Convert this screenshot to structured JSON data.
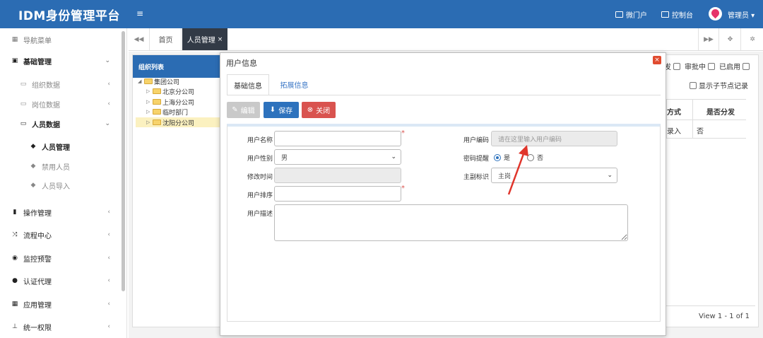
{
  "header": {
    "app_title": "IDM身份管理平台",
    "menu_toggle": "≡",
    "links": [
      {
        "label": "微门户",
        "icon": "id-card-icon"
      },
      {
        "label": "控制台",
        "icon": "monitor-icon"
      }
    ],
    "user_label": "管理员 ▾"
  },
  "sidebar": {
    "nav_title": "导航菜单",
    "items": [
      {
        "label": "基础管理",
        "icon": "id-card-icon",
        "arrow": "⌄"
      },
      {
        "label": "组织数据",
        "arrow": "‹"
      },
      {
        "label": "岗位数据",
        "arrow": "‹"
      },
      {
        "label": "人员数据",
        "arrow": "⌄"
      },
      {
        "label": "人员管理"
      },
      {
        "label": "禁用人员"
      },
      {
        "label": "人员导入"
      },
      {
        "label": "操作管理",
        "icon": "book-icon",
        "arrow": "‹"
      },
      {
        "label": "流程中心",
        "icon": "random-icon",
        "arrow": "‹"
      },
      {
        "label": "监控预警",
        "icon": "eye-icon",
        "arrow": "‹"
      },
      {
        "label": "认证代理",
        "icon": "users-icon",
        "arrow": "‹"
      },
      {
        "label": "应用管理",
        "icon": "grid-icon",
        "arrow": "‹"
      },
      {
        "label": "统一权限",
        "icon": "sitemap-icon",
        "arrow": "‹"
      }
    ]
  },
  "tabs": {
    "home": "首页",
    "active": "人员管理",
    "close": "×"
  },
  "org_panel": {
    "title": "组织列表",
    "tree": [
      "集团公司",
      "北京分公司",
      "上海分公司",
      "临时部门",
      "沈阳分公司"
    ]
  },
  "background": {
    "filters": [
      "发",
      "审批中",
      "已启用"
    ],
    "show_child": "显示子节点记录",
    "columns": [
      "方式",
      "是否分发"
    ],
    "row": [
      "录入",
      "否"
    ],
    "pagination": "View 1 - 1 of 1"
  },
  "modal": {
    "title": "用户信息",
    "close": "×",
    "tabs": [
      "基础信息",
      "拓展信息"
    ],
    "buttons": {
      "edit": "编辑",
      "save": "保存",
      "close": "关闭"
    },
    "form": {
      "user_name_label": "用户名称",
      "user_code_label": "用户编码",
      "user_code_placeholder": "请在这里输入用户编码",
      "gender_label": "用户性别",
      "gender_value": "男",
      "password_remind_label": "密码提醒",
      "radio_yes": "是",
      "radio_no": "否",
      "password_remind_value": "是",
      "modified_label": "修改时间",
      "primary_label": "主副标识",
      "primary_value": "主岗",
      "sort_label": "用户排序",
      "desc_label": "用户描述",
      "required_mark": "*"
    }
  },
  "colors": {
    "header_bg": "#2b6cb3",
    "active_tab_bg": "#323a46",
    "save_btn": "#2d72bd",
    "close_btn": "#d9534f",
    "annotation_arrow": "#e0352b"
  }
}
